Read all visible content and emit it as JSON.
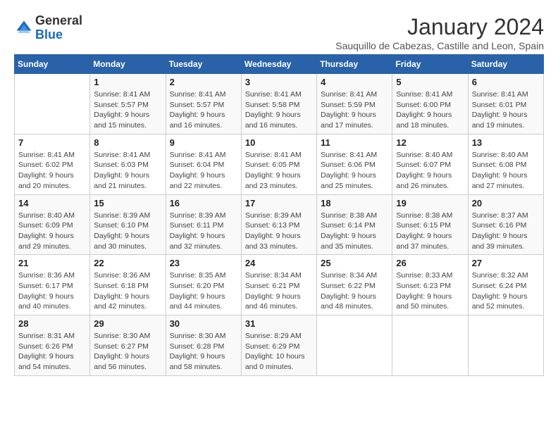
{
  "header": {
    "logo_general": "General",
    "logo_blue": "Blue",
    "month_title": "January 2024",
    "subtitle": "Sauquillo de Cabezas, Castille and Leon, Spain"
  },
  "weekdays": [
    "Sunday",
    "Monday",
    "Tuesday",
    "Wednesday",
    "Thursday",
    "Friday",
    "Saturday"
  ],
  "weeks": [
    [
      {
        "day": "",
        "info": ""
      },
      {
        "day": "1",
        "info": "Sunrise: 8:41 AM\nSunset: 5:57 PM\nDaylight: 9 hours\nand 15 minutes."
      },
      {
        "day": "2",
        "info": "Sunrise: 8:41 AM\nSunset: 5:57 PM\nDaylight: 9 hours\nand 16 minutes."
      },
      {
        "day": "3",
        "info": "Sunrise: 8:41 AM\nSunset: 5:58 PM\nDaylight: 9 hours\nand 16 minutes."
      },
      {
        "day": "4",
        "info": "Sunrise: 8:41 AM\nSunset: 5:59 PM\nDaylight: 9 hours\nand 17 minutes."
      },
      {
        "day": "5",
        "info": "Sunrise: 8:41 AM\nSunset: 6:00 PM\nDaylight: 9 hours\nand 18 minutes."
      },
      {
        "day": "6",
        "info": "Sunrise: 8:41 AM\nSunset: 6:01 PM\nDaylight: 9 hours\nand 19 minutes."
      }
    ],
    [
      {
        "day": "7",
        "info": "Sunrise: 8:41 AM\nSunset: 6:02 PM\nDaylight: 9 hours\nand 20 minutes."
      },
      {
        "day": "8",
        "info": "Sunrise: 8:41 AM\nSunset: 6:03 PM\nDaylight: 9 hours\nand 21 minutes."
      },
      {
        "day": "9",
        "info": "Sunrise: 8:41 AM\nSunset: 6:04 PM\nDaylight: 9 hours\nand 22 minutes."
      },
      {
        "day": "10",
        "info": "Sunrise: 8:41 AM\nSunset: 6:05 PM\nDaylight: 9 hours\nand 23 minutes."
      },
      {
        "day": "11",
        "info": "Sunrise: 8:41 AM\nSunset: 6:06 PM\nDaylight: 9 hours\nand 25 minutes."
      },
      {
        "day": "12",
        "info": "Sunrise: 8:40 AM\nSunset: 6:07 PM\nDaylight: 9 hours\nand 26 minutes."
      },
      {
        "day": "13",
        "info": "Sunrise: 8:40 AM\nSunset: 6:08 PM\nDaylight: 9 hours\nand 27 minutes."
      }
    ],
    [
      {
        "day": "14",
        "info": "Sunrise: 8:40 AM\nSunset: 6:09 PM\nDaylight: 9 hours\nand 29 minutes."
      },
      {
        "day": "15",
        "info": "Sunrise: 8:39 AM\nSunset: 6:10 PM\nDaylight: 9 hours\nand 30 minutes."
      },
      {
        "day": "16",
        "info": "Sunrise: 8:39 AM\nSunset: 6:11 PM\nDaylight: 9 hours\nand 32 minutes."
      },
      {
        "day": "17",
        "info": "Sunrise: 8:39 AM\nSunset: 6:13 PM\nDaylight: 9 hours\nand 33 minutes."
      },
      {
        "day": "18",
        "info": "Sunrise: 8:38 AM\nSunset: 6:14 PM\nDaylight: 9 hours\nand 35 minutes."
      },
      {
        "day": "19",
        "info": "Sunrise: 8:38 AM\nSunset: 6:15 PM\nDaylight: 9 hours\nand 37 minutes."
      },
      {
        "day": "20",
        "info": "Sunrise: 8:37 AM\nSunset: 6:16 PM\nDaylight: 9 hours\nand 39 minutes."
      }
    ],
    [
      {
        "day": "21",
        "info": "Sunrise: 8:36 AM\nSunset: 6:17 PM\nDaylight: 9 hours\nand 40 minutes."
      },
      {
        "day": "22",
        "info": "Sunrise: 8:36 AM\nSunset: 6:18 PM\nDaylight: 9 hours\nand 42 minutes."
      },
      {
        "day": "23",
        "info": "Sunrise: 8:35 AM\nSunset: 6:20 PM\nDaylight: 9 hours\nand 44 minutes."
      },
      {
        "day": "24",
        "info": "Sunrise: 8:34 AM\nSunset: 6:21 PM\nDaylight: 9 hours\nand 46 minutes."
      },
      {
        "day": "25",
        "info": "Sunrise: 8:34 AM\nSunset: 6:22 PM\nDaylight: 9 hours\nand 48 minutes."
      },
      {
        "day": "26",
        "info": "Sunrise: 8:33 AM\nSunset: 6:23 PM\nDaylight: 9 hours\nand 50 minutes."
      },
      {
        "day": "27",
        "info": "Sunrise: 8:32 AM\nSunset: 6:24 PM\nDaylight: 9 hours\nand 52 minutes."
      }
    ],
    [
      {
        "day": "28",
        "info": "Sunrise: 8:31 AM\nSunset: 6:26 PM\nDaylight: 9 hours\nand 54 minutes."
      },
      {
        "day": "29",
        "info": "Sunrise: 8:30 AM\nSunset: 6:27 PM\nDaylight: 9 hours\nand 56 minutes."
      },
      {
        "day": "30",
        "info": "Sunrise: 8:30 AM\nSunset: 6:28 PM\nDaylight: 9 hours\nand 58 minutes."
      },
      {
        "day": "31",
        "info": "Sunrise: 8:29 AM\nSunset: 6:29 PM\nDaylight: 10 hours\nand 0 minutes."
      },
      {
        "day": "",
        "info": ""
      },
      {
        "day": "",
        "info": ""
      },
      {
        "day": "",
        "info": ""
      }
    ]
  ]
}
